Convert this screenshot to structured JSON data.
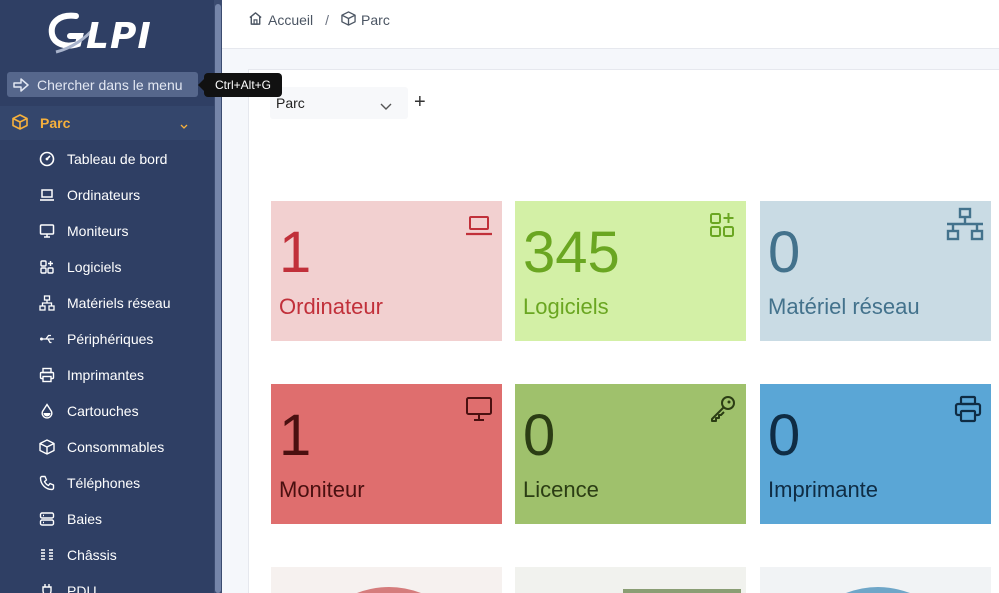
{
  "app": {
    "logo_text": "GLPI"
  },
  "sidebar": {
    "search_label": "Chercher dans le menu",
    "search_shortcut": "Ctrl+Alt+G",
    "section_label": "Parc",
    "items": [
      {
        "label": "Tableau de bord",
        "icon": "dashboard-icon"
      },
      {
        "label": "Ordinateurs",
        "icon": "laptop-icon"
      },
      {
        "label": "Moniteurs",
        "icon": "monitor-icon"
      },
      {
        "label": "Logiciels",
        "icon": "apps-icon"
      },
      {
        "label": "Matériels réseau",
        "icon": "network-icon"
      },
      {
        "label": "Périphériques",
        "icon": "usb-icon"
      },
      {
        "label": "Imprimantes",
        "icon": "printer-icon"
      },
      {
        "label": "Cartouches",
        "icon": "droplet-icon"
      },
      {
        "label": "Consommables",
        "icon": "package-icon"
      },
      {
        "label": "Téléphones",
        "icon": "phone-icon"
      },
      {
        "label": "Baies",
        "icon": "server-icon"
      },
      {
        "label": "Châssis",
        "icon": "columns-icon"
      },
      {
        "label": "PDU",
        "icon": "plug-icon"
      }
    ]
  },
  "breadcrumb": {
    "home": "Accueil",
    "separator": "/",
    "current": "Parc"
  },
  "dashboard": {
    "selected": "Parc",
    "add_label": "+"
  },
  "cards": [
    {
      "value": "1",
      "label": "Ordinateur",
      "icon": "laptop-icon",
      "bg": "#f2d0d0",
      "fg": "#c1303a"
    },
    {
      "value": "345",
      "label": "Logiciels",
      "icon": "apps-add-icon",
      "bg": "#d3f0a6",
      "fg": "#6aa621"
    },
    {
      "value": "0",
      "label": "Matériel réseau",
      "icon": "network-icon",
      "bg": "#c9dbe4",
      "fg": "#43728c"
    },
    {
      "value": "1",
      "label": "Moniteur",
      "icon": "monitor-icon",
      "bg": "#df6e6e",
      "fg": "#4a1010"
    },
    {
      "value": "0",
      "label": "Licence",
      "icon": "key-icon",
      "bg": "#9fc16c",
      "fg": "#2b3d14"
    },
    {
      "value": "0",
      "label": "Imprimante",
      "icon": "printer-icon",
      "bg": "#5aa6d6",
      "fg": "#0f2c44"
    }
  ],
  "colors": {
    "sidebar_bg": "#2f3f64",
    "active_section": "#f6b03c"
  }
}
